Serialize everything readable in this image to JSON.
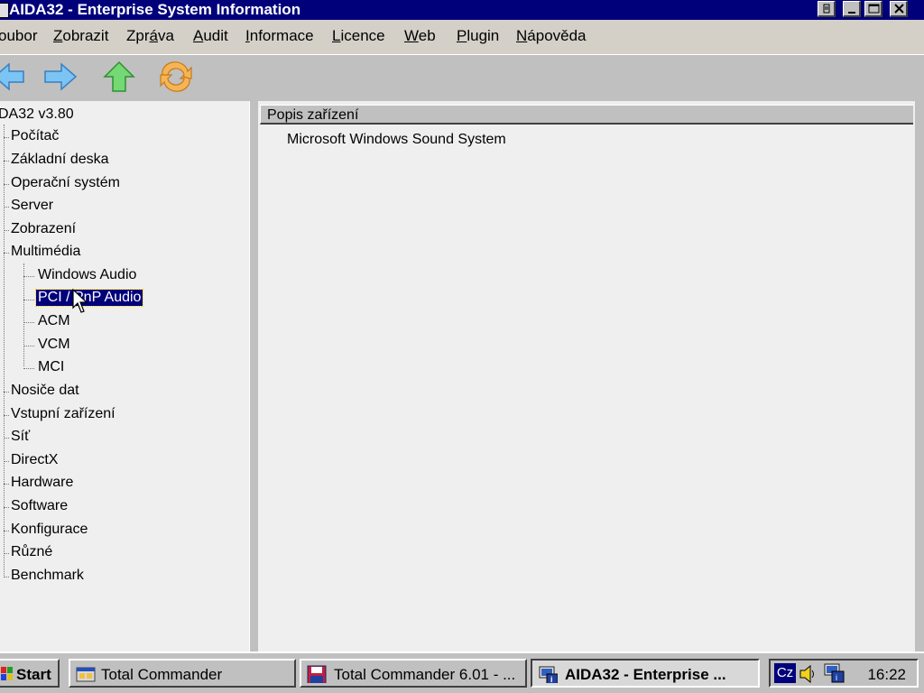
{
  "window": {
    "title": "AIDA32 - Enterprise System Information"
  },
  "menu": [
    "Soubor",
    "Zobrazit",
    "Zpráva",
    "Audit",
    "Informace",
    "Licence",
    "Web",
    "Plugin",
    "Nápověda"
  ],
  "menu_display": [
    "oubor",
    "Zobrazit",
    "Zpráva",
    "Audit",
    "Informace",
    "Licence",
    "Web",
    "Plugin",
    "Nápověda"
  ],
  "toolbar": {
    "icons": [
      "back-arrow-icon",
      "forward-arrow-icon",
      "up-arrow-icon",
      "refresh-icon"
    ]
  },
  "tree": {
    "root": "DA32 v3.80",
    "items": [
      {
        "label": "Počítač"
      },
      {
        "label": "Základní deska"
      },
      {
        "label": "Operační systém"
      },
      {
        "label": "Server"
      },
      {
        "label": "Zobrazení"
      },
      {
        "label": "Multimédia",
        "children": [
          "Windows Audio",
          "PCI / PnP Audio",
          "ACM",
          "VCM",
          "MCI"
        ]
      },
      {
        "label": "Nosiče dat"
      },
      {
        "label": "Vstupní zařízení"
      },
      {
        "label": "Síť"
      },
      {
        "label": "DirectX"
      },
      {
        "label": "Hardware"
      },
      {
        "label": "Software"
      },
      {
        "label": "Konfigurace"
      },
      {
        "label": "Různé"
      },
      {
        "label": "Benchmark"
      }
    ],
    "selected": "PCI / PnP Audio"
  },
  "detail": {
    "column_header": "Popis zařízení",
    "rows": [
      "Microsoft Windows Sound System"
    ]
  },
  "taskbar": {
    "start": "Start",
    "tasks": [
      "Total Commander",
      "Total Commander 6.01 - ...",
      "AIDA32 - Enterprise ..."
    ],
    "active_task": "AIDA32 - Enterprise ...",
    "tray": {
      "language": "Cz",
      "time": "16:22"
    }
  },
  "colors": {
    "titlebar": "#00007b",
    "selection": "#00007b",
    "face": "#c0c0c0"
  }
}
